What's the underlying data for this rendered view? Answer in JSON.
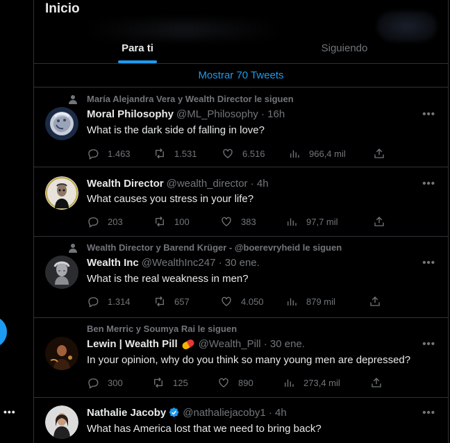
{
  "header": {
    "title": "Inicio"
  },
  "tabs": [
    {
      "label": "Para ti",
      "active": true
    },
    {
      "label": "Siguiendo",
      "active": false
    }
  ],
  "show_more": "Mostrar 70 Tweets",
  "tweets": [
    {
      "social": "María Alejandra Vera y Wealth Director le siguen",
      "name": "Moral Philosophy",
      "handle": "@ML_Philosophy · 16h",
      "text": "What is the dark side of falling in love?",
      "replies": "1.463",
      "retweets": "1.531",
      "likes": "6.516",
      "views": "966,4 mil"
    },
    {
      "social": "",
      "name": "Wealth Director",
      "handle": "@wealth_director · 4h",
      "text": "What causes you stress in your life?",
      "replies": "203",
      "retweets": "100",
      "likes": "383",
      "views": "97,7 mil"
    },
    {
      "social": "Wealth Director y Barend Krüger - @boerevryheid le siguen",
      "name": "Wealth Inc",
      "handle": "@WealthInc247 · 30 ene.",
      "text": "What is the real weakness in men?",
      "replies": "1.314",
      "retweets": "657",
      "likes": "4.050",
      "views": "879 mil"
    },
    {
      "social": "Ben Merric y Soumya Rai le siguen",
      "name": "Lewin | Wealth Pill",
      "handle": "@Wealth_Pill · 30 ene.",
      "text": "In your opinion, why do you think so many young men are depressed?",
      "replies": "300",
      "retweets": "125",
      "likes": "890",
      "views": "273,4 mil"
    },
    {
      "social": "",
      "name": "Nathalie Jacoby",
      "handle": "@nathaliejacoby1 · 4h",
      "text": "What has America lost that we need to bring back?",
      "replies": "",
      "retweets": "",
      "likes": "",
      "views": ""
    }
  ],
  "colors": {
    "accent": "#1d9bf0",
    "muted": "#71767b",
    "text": "#e7e9ea",
    "border": "#2f3336",
    "background": "#000000"
  },
  "icons": {
    "social": "person-icon",
    "reply": "reply-icon",
    "retweet": "retweet-icon",
    "like": "heart-icon",
    "views": "views-icon",
    "share": "share-icon",
    "more": "more-icon"
  },
  "rail": {
    "more": "•••"
  },
  "more_label": "•••"
}
